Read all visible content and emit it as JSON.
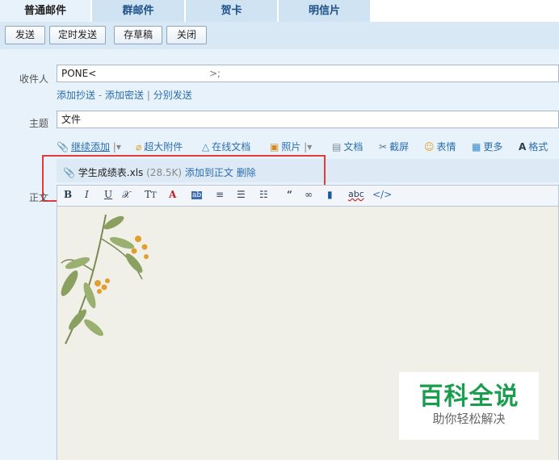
{
  "tabs": [
    {
      "label": "普通邮件",
      "active": true
    },
    {
      "label": "群邮件",
      "active": false
    },
    {
      "label": "贺卡",
      "active": false
    },
    {
      "label": "明信片",
      "active": false
    }
  ],
  "toolbar": {
    "send": "发送",
    "scheduled_send": "定时发送",
    "save_draft": "存草稿",
    "close": "关闭"
  },
  "compose": {
    "to_label": "收件人",
    "to_name": "PONE<",
    "to_suffix": ">;",
    "cc_links": {
      "add_cc": "添加抄送",
      "dash": "-",
      "add_bcc": "添加密送",
      "bar": "|",
      "separate_send": "分别发送"
    },
    "subject_label": "主题",
    "subject_value": "文件",
    "body_label": "正文"
  },
  "attach_toolbar": {
    "continue_add": "继续添加",
    "large_attach": "超大附件",
    "online_doc": "在线文档",
    "photo": "照片",
    "document": "文档",
    "screenshot": "截屏",
    "emoji": "表情",
    "more": "更多",
    "format": "格式"
  },
  "attachment": {
    "filename": "学生成绩表.xls",
    "size": "(28.5K)",
    "add_to_body": "添加到正文",
    "delete": "删除"
  },
  "format_toolbar": {
    "bold": "B",
    "italic": "I",
    "underline": "U",
    "abc": "abc",
    "code": "</>"
  },
  "watermark": {
    "title": "百科全说",
    "subtitle": "助你轻松解决"
  },
  "colors": {
    "accent": "#2a6db0",
    "highlight_border": "#e23b3b",
    "watermark_green": "#1a9e4e"
  }
}
